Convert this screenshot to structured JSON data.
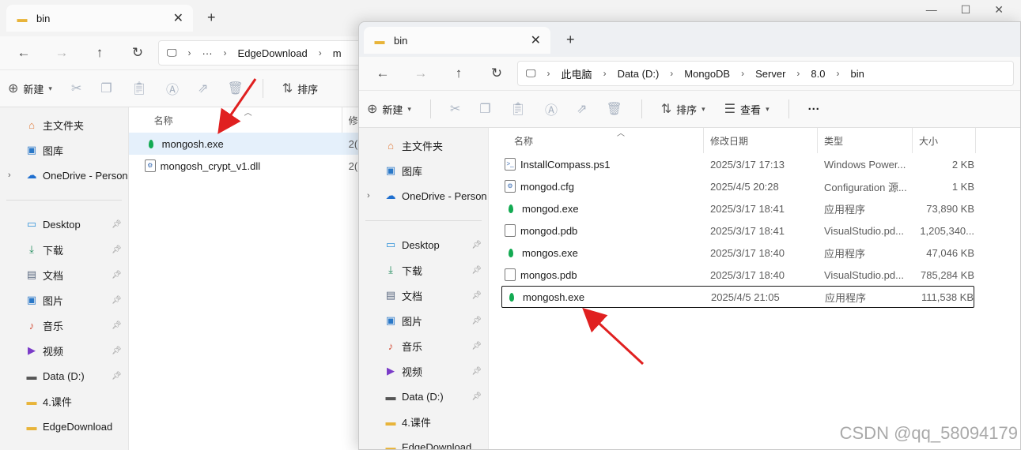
{
  "back_window": {
    "tab_title": "bin",
    "breadcrumb": [
      "EdgeDownload",
      "m"
    ],
    "new_label": "新建",
    "sort_label": "排序",
    "col_name": "名称",
    "col_date_fragment": "修",
    "files": [
      {
        "name": "mongosh.exe",
        "icon": "mongodb-leaf-icon",
        "date_fragment": "2("
      },
      {
        "name": "mongosh_crypt_v1.dll",
        "icon": "dll-file-icon",
        "date_fragment": "2("
      }
    ],
    "sidebar": {
      "top": [
        {
          "label": "主文件夹",
          "icon": "home-icon"
        },
        {
          "label": "图库",
          "icon": "gallery-icon"
        },
        {
          "label": "OneDrive - Person",
          "icon": "onedrive-icon"
        }
      ],
      "quick": [
        {
          "label": "Desktop",
          "icon": "desktop-icon"
        },
        {
          "label": "下载",
          "icon": "download-icon"
        },
        {
          "label": "文档",
          "icon": "documents-icon"
        },
        {
          "label": "图片",
          "icon": "pictures-icon"
        },
        {
          "label": "音乐",
          "icon": "music-icon"
        },
        {
          "label": "视频",
          "icon": "videos-icon"
        },
        {
          "label": "Data (D:)",
          "icon": "drive-icon"
        },
        {
          "label": "4.课件",
          "icon": "folder-icon"
        },
        {
          "label": "EdgeDownload",
          "icon": "folder-icon"
        }
      ]
    }
  },
  "front_window": {
    "tab_title": "bin",
    "breadcrumb": [
      "此电脑",
      "Data (D:)",
      "MongoDB",
      "Server",
      "8.0",
      "bin"
    ],
    "toolbar": {
      "new": "新建",
      "sort": "排序",
      "view": "查看",
      "more": "···"
    },
    "columns": {
      "name": "名称",
      "date": "修改日期",
      "type": "类型",
      "size": "大小"
    },
    "files": [
      {
        "name": "InstallCompass.ps1",
        "date": "2025/3/17 17:13",
        "type": "Windows Power...",
        "size": "2 KB",
        "icon": "ps1-file-icon"
      },
      {
        "name": "mongod.cfg",
        "date": "2025/4/5 20:28",
        "type": "Configuration 源...",
        "size": "1 KB",
        "icon": "config-file-icon"
      },
      {
        "name": "mongod.exe",
        "date": "2025/3/17 18:41",
        "type": "应用程序",
        "size": "73,890 KB",
        "icon": "mongodb-leaf-icon"
      },
      {
        "name": "mongod.pdb",
        "date": "2025/3/17 18:41",
        "type": "VisualStudio.pd...",
        "size": "1,205,340...",
        "icon": "pdb-file-icon"
      },
      {
        "name": "mongos.exe",
        "date": "2025/3/17 18:40",
        "type": "应用程序",
        "size": "47,046 KB",
        "icon": "mongodb-leaf-icon"
      },
      {
        "name": "mongos.pdb",
        "date": "2025/3/17 18:40",
        "type": "VisualStudio.pd...",
        "size": "785,284 KB",
        "icon": "pdb-file-icon"
      },
      {
        "name": "mongosh.exe",
        "date": "2025/4/5 21:05",
        "type": "应用程序",
        "size": "111,538 KB",
        "icon": "mongodb-leaf-icon"
      }
    ],
    "sidebar": {
      "top": [
        {
          "label": "主文件夹",
          "icon": "home-icon"
        },
        {
          "label": "图库",
          "icon": "gallery-icon"
        },
        {
          "label": "OneDrive - Person",
          "icon": "onedrive-icon"
        }
      ],
      "quick": [
        {
          "label": "Desktop",
          "icon": "desktop-icon"
        },
        {
          "label": "下载",
          "icon": "download-icon"
        },
        {
          "label": "文档",
          "icon": "documents-icon"
        },
        {
          "label": "图片",
          "icon": "pictures-icon"
        },
        {
          "label": "音乐",
          "icon": "music-icon"
        },
        {
          "label": "视频",
          "icon": "videos-icon"
        },
        {
          "label": "Data (D:)",
          "icon": "drive-icon"
        },
        {
          "label": "4.课件",
          "icon": "folder-icon"
        },
        {
          "label": "EdgeDownload",
          "icon": "folder-icon"
        }
      ]
    }
  },
  "colors": {
    "annotation_arrow": "#e02020",
    "mongodb_green": "#13aa52",
    "selection_border": "#1a1a1a"
  },
  "watermark": "CSDN @qq_58094179"
}
